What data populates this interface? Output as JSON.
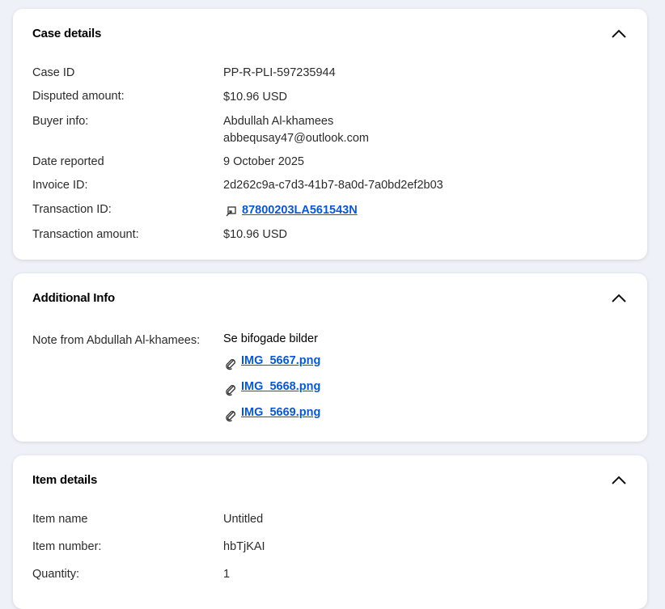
{
  "case_details": {
    "title": "Case details",
    "rows": {
      "case_id": {
        "label": "Case ID",
        "value": "PP-R-PLI-597235944"
      },
      "disputed_amount": {
        "label": "Disputed amount:",
        "value": "$10.96 USD"
      },
      "buyer_info": {
        "label": "Buyer info:",
        "name": "Abdullah Al-khamees",
        "email": "abbequsay47@outlook.com"
      },
      "date_reported": {
        "label": "Date reported",
        "value": "9 October 2025"
      },
      "invoice_id": {
        "label": "Invoice ID:",
        "value": "2d262c9a-c7d3-41b7-8a0d-7a0bd2ef2b03"
      },
      "transaction_id": {
        "label": "Transaction ID:",
        "value": "87800203LA561543N",
        "icon": "external-link-icon"
      },
      "transaction_amount": {
        "label": "Transaction amount:",
        "value": "$10.96 USD"
      }
    }
  },
  "additional_info": {
    "title": "Additional Info",
    "note_label": "Note from Abdullah Al-khamees:",
    "note_text": "Se bifogade bilder",
    "attachments": [
      "IMG_5667.png",
      "IMG_5668.png",
      "IMG_5669.png"
    ],
    "attachment_icon": "paperclip-icon"
  },
  "item_details": {
    "title": "Item details",
    "rows": {
      "item_name": {
        "label": "Item name",
        "value": "Untitled"
      },
      "item_number": {
        "label": "Item number:",
        "value": "hbTjKAI"
      },
      "quantity": {
        "label": "Quantity:",
        "value": "1"
      }
    }
  },
  "colors": {
    "page_background": "#eef1f7",
    "card_background": "#ffffff",
    "link": "#0a58ca"
  }
}
